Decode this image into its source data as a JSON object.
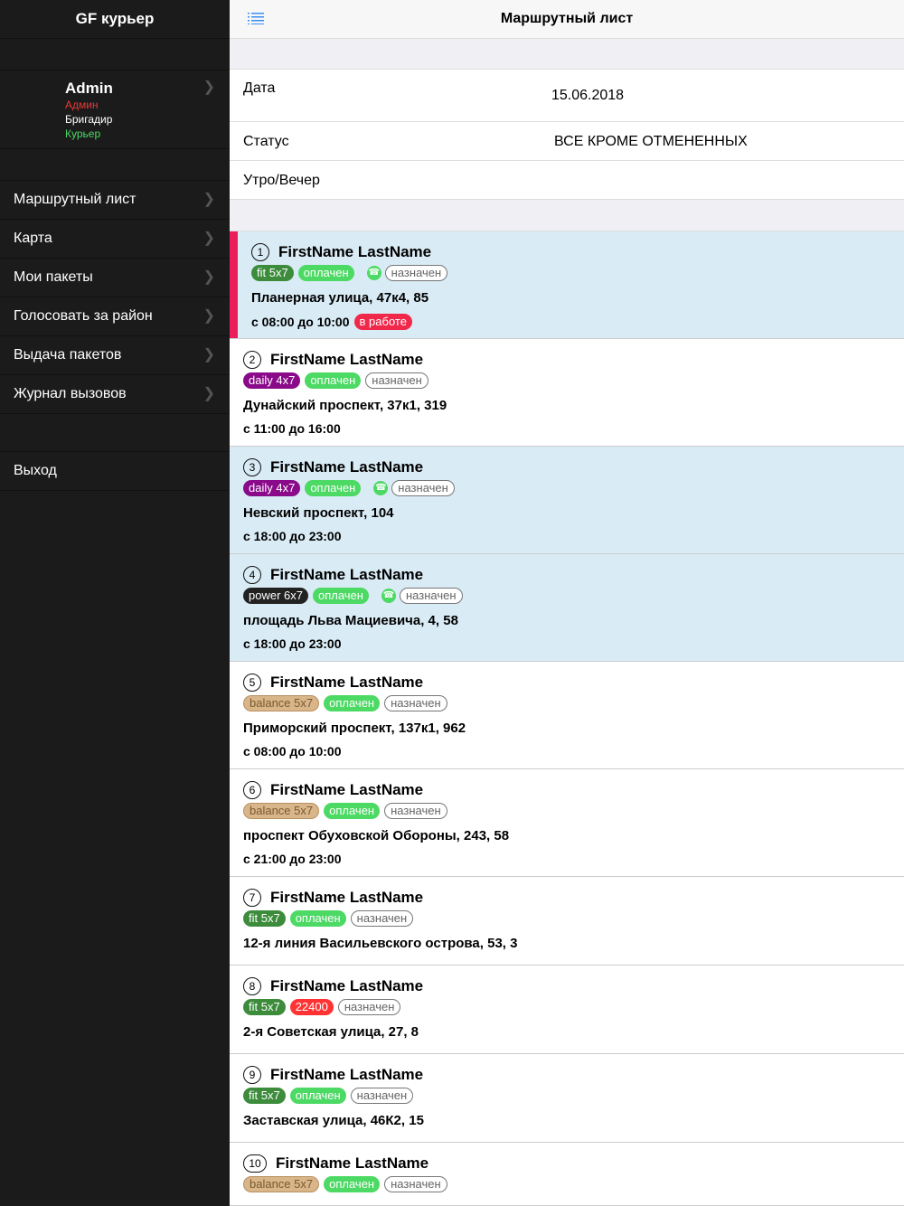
{
  "sidebar": {
    "title": "GF курьер",
    "profile": {
      "name": "Admin",
      "roles": [
        "Админ",
        "Бригадир",
        "Курьер"
      ]
    },
    "items": [
      {
        "label": "Маршрутный лист"
      },
      {
        "label": "Карта"
      },
      {
        "label": "Мои пакеты"
      },
      {
        "label": "Голосовать за район"
      },
      {
        "label": "Выдача пакетов"
      },
      {
        "label": "Журнал вызовов"
      }
    ],
    "logout": "Выход"
  },
  "header": {
    "title": "Маршрутный лист"
  },
  "filters": {
    "date_label": "Дата",
    "date_value": "15.06.2018",
    "status_label": "Статус",
    "status_value": "ВСЕ КРОМЕ ОТМЕНЕННЫХ",
    "shift_label": "Утро/Вечер"
  },
  "orders": [
    {
      "n": "1",
      "name": "FirstName LastName",
      "plan": "fit 5x7",
      "plan_type": "fit",
      "pay": "оплачен",
      "phone": true,
      "status": "назначен",
      "address": "Планерная улица, 47к4, 85",
      "time": "с 08:00 до 10:00",
      "badge": "в работе",
      "highlight": true,
      "active": true
    },
    {
      "n": "2",
      "name": "FirstName LastName",
      "plan": "daily 4x7",
      "plan_type": "daily",
      "pay": "оплачен",
      "phone": false,
      "status": "назначен",
      "address": "Дунайский проспект, 37к1, 319",
      "time": "с 11:00 до 16:00"
    },
    {
      "n": "3",
      "name": "FirstName LastName",
      "plan": "daily 4x7",
      "plan_type": "daily",
      "pay": "оплачен",
      "phone": true,
      "status": "назначен",
      "address": "Невский проспект, 104",
      "time": "с 18:00 до 23:00",
      "highlight": true
    },
    {
      "n": "4",
      "name": "FirstName LastName",
      "plan": "power 6x7",
      "plan_type": "power",
      "pay": "оплачен",
      "phone": true,
      "status": "назначен",
      "address": "площадь Льва Мациевича, 4, 58",
      "time": "с 18:00 до 23:00",
      "highlight": true
    },
    {
      "n": "5",
      "name": "FirstName LastName",
      "plan": "balance 5x7",
      "plan_type": "balance",
      "pay": "оплачен",
      "phone": false,
      "status": "назначен",
      "address": "Приморский проспект, 137к1, 962",
      "time": "с 08:00 до 10:00"
    },
    {
      "n": "6",
      "name": "FirstName LastName",
      "plan": "balance 5x7",
      "plan_type": "balance",
      "pay": "оплачен",
      "phone": false,
      "status": "назначен",
      "address": "проспект Обуховской Обороны, 243, 58",
      "time": "с 21:00 до 23:00"
    },
    {
      "n": "7",
      "name": "FirstName LastName",
      "plan": "fit 5x7",
      "plan_type": "fit",
      "pay": "оплачен",
      "phone": false,
      "status": "назначен",
      "address": "12-я линия Васильевского острова, 53, 3"
    },
    {
      "n": "8",
      "name": "FirstName LastName",
      "plan": "fit 5x7",
      "plan_type": "fit",
      "pay": "22400",
      "pay_unpaid": true,
      "phone": false,
      "status": "назначен",
      "address": "2-я Советская улица, 27, 8"
    },
    {
      "n": "9",
      "name": "FirstName LastName",
      "plan": "fit 5x7",
      "plan_type": "fit",
      "pay": "оплачен",
      "phone": false,
      "status": "назначен",
      "address": "Заставская улица, 46К2, 15"
    },
    {
      "n": "10",
      "name": "FirstName LastName",
      "plan": "balance 5x7",
      "plan_type": "balance",
      "pay": "оплачен",
      "phone": false,
      "status": "назначен"
    }
  ]
}
